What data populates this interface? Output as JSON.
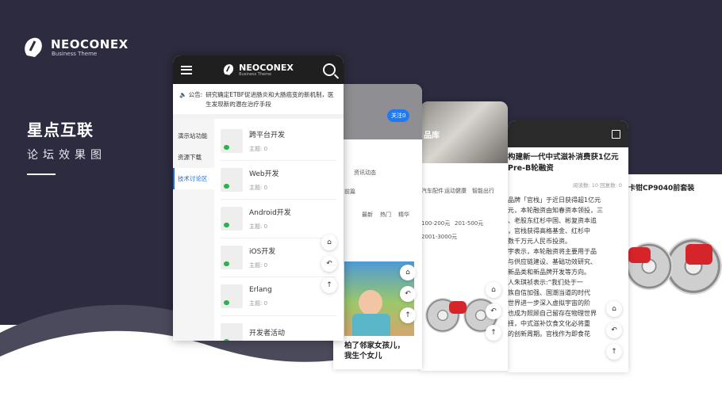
{
  "brand": {
    "name": "NEOCONEX",
    "sub": "Business Theme"
  },
  "headline": {
    "title": "星点互联",
    "subtitle": "论坛效果图"
  },
  "phone1": {
    "nav_brand": "NEOCONEX",
    "nav_sub": "Business Theme",
    "notice_label": "公告:",
    "notice_text": "研究确定ETBF促进肠炎和大肠癌变的新机制，医生发现新的潜在治疗手段",
    "side_tabs": [
      {
        "label": "演示站功能"
      },
      {
        "label": "资源下载"
      },
      {
        "label": "技术讨论区",
        "active": true
      }
    ],
    "forums": [
      {
        "title": "跨平台开发",
        "count": "主题: 0"
      },
      {
        "title": "Web开发",
        "count": "主题: 0"
      },
      {
        "title": "Android开发",
        "count": "主题: 0"
      },
      {
        "title": "iOS开发",
        "count": "主题: 0"
      },
      {
        "title": "Erlang",
        "count": "主题: 0"
      },
      {
        "title": "开发者活动",
        "count": ""
      }
    ]
  },
  "phone2": {
    "follow": "关注0",
    "tab_news": "资讯动态",
    "front": "前篇",
    "filters": [
      "最新",
      "热门",
      "精华"
    ],
    "caption": "柏了邻家女孩儿，",
    "caption2": "我生个女儿"
  },
  "phone3": {
    "title_frag": "品库",
    "cats": [
      "汽车配件",
      "运动健康",
      "智能出行"
    ],
    "prices": [
      "100-200元",
      "201-500元",
      "2001-3000元"
    ]
  },
  "phone4": {
    "title": "构建新一代中式滋补消费获1亿元Pre-B轮融资",
    "meta": "阅读数: 10  回复数: 0",
    "lines": [
      "品牌「官栈」于近日获得超1亿元",
      "元，本轮融资由知春资本领投，三",
      "、老股东红杉中国、彬复资本追",
      "，官栈获得高格基金、红杉中",
      "数千万元人民币投资。",
      "宇表示，本轮融资将主要用于品",
      "与供应链建设、基础功效研究、",
      "新品类和新品牌开发等方向。",
      "人朱琪祯表示:“我们处于一",
      "族自信加强、国潮当道的时代",
      "世界进一步深入虚拟宇宙的阶",
      "也成为照顾自己留存在物理世界",
      "择，中式滋补饮食文化必将重",
      "的创新周期。官栈作为即食花"
    ]
  },
  "phone5": {
    "title": "卡钳CP9040前套装"
  }
}
